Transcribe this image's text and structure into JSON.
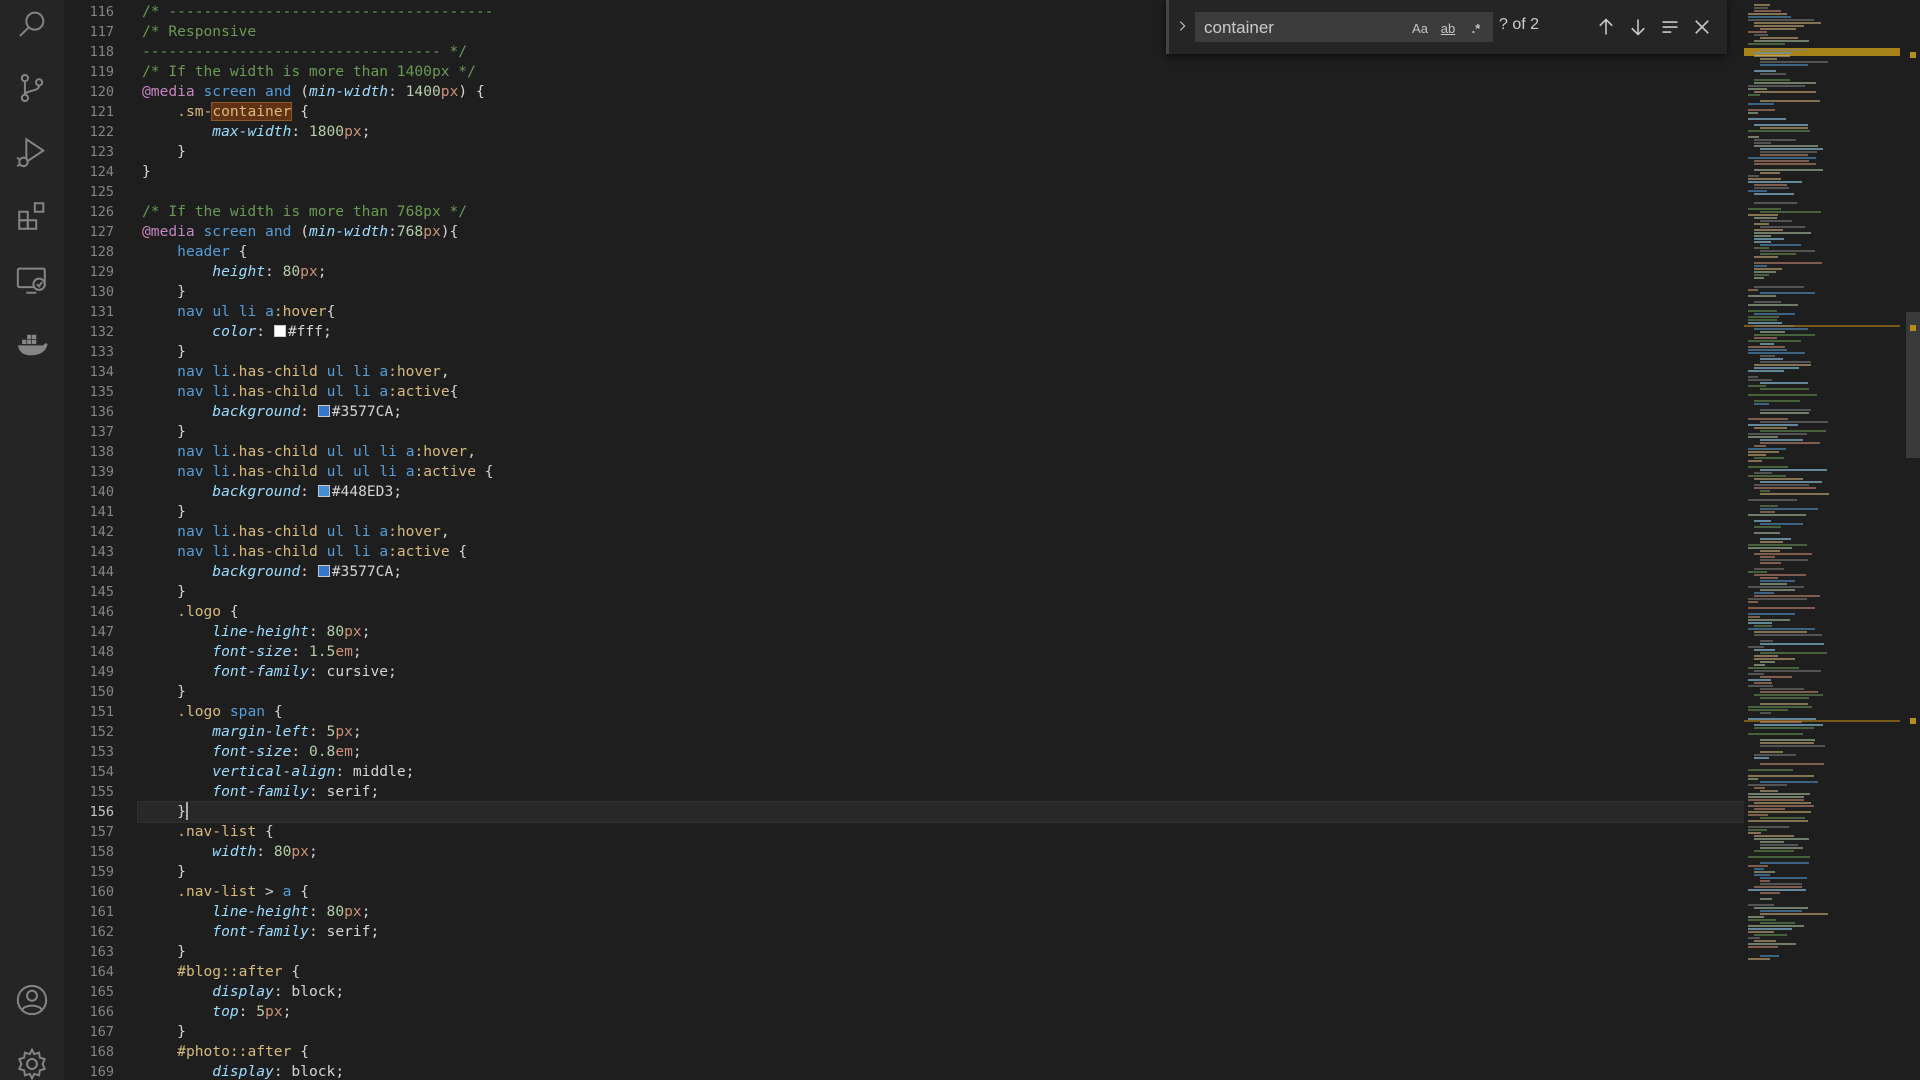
{
  "find": {
    "query": "container",
    "match_case_label": "Aa",
    "whole_word_label": "ab",
    "regex_label": ".*",
    "match_count": "? of 2"
  },
  "icons": {
    "activity": [
      "search-icon",
      "source-control-icon",
      "run-debug-icon",
      "extensions-icon",
      "remote-explorer-icon",
      "docker-icon",
      "account-icon",
      "settings-gear-icon"
    ],
    "find": [
      "chevron-right-icon",
      "arrow-up-icon",
      "arrow-down-icon",
      "find-in-selection-icon",
      "close-icon"
    ]
  },
  "colors": {
    "editor_bg": "#1e1e1e",
    "activity_bar_bg": "#252526",
    "find_match": "#613214",
    "minimap_highlight": "#b58d18"
  },
  "editor": {
    "current_line": 156,
    "lines": [
      {
        "n": "116",
        "text": "/* -------------------------------------"
      },
      {
        "n": "117",
        "text": "/* Responsive"
      },
      {
        "n": "118",
        "text": "---------------------------------- */"
      },
      {
        "n": "119",
        "text": "/* If the width is more than 1400px */"
      },
      {
        "n": "120",
        "text": "@media screen and (min-width: 1400px) {"
      },
      {
        "n": "121",
        "text": "    .sm-container {"
      },
      {
        "n": "122",
        "text": "        max-width: 1800px;"
      },
      {
        "n": "123",
        "text": "    }"
      },
      {
        "n": "124",
        "text": "}"
      },
      {
        "n": "125",
        "text": ""
      },
      {
        "n": "126",
        "text": "/* If the width is more than 768px */"
      },
      {
        "n": "127",
        "text": "@media screen and (min-width:768px){"
      },
      {
        "n": "128",
        "text": "    header {"
      },
      {
        "n": "129",
        "text": "        height: 80px;"
      },
      {
        "n": "130",
        "text": "    }"
      },
      {
        "n": "131",
        "text": "    nav ul li a:hover{"
      },
      {
        "n": "132",
        "text": "        color: #fff;"
      },
      {
        "n": "133",
        "text": "    }"
      },
      {
        "n": "134",
        "text": "    nav li.has-child ul li a:hover,"
      },
      {
        "n": "135",
        "text": "    nav li.has-child ul li a:active{"
      },
      {
        "n": "136",
        "text": "        background: #3577CA;"
      },
      {
        "n": "137",
        "text": "    }"
      },
      {
        "n": "138",
        "text": "    nav li.has-child ul ul li a:hover,"
      },
      {
        "n": "139",
        "text": "    nav li.has-child ul ul li a:active {"
      },
      {
        "n": "140",
        "text": "        background: #448ED3;"
      },
      {
        "n": "141",
        "text": "    }"
      },
      {
        "n": "142",
        "text": "    nav li.has-child ul li a:hover,"
      },
      {
        "n": "143",
        "text": "    nav li.has-child ul li a:active {"
      },
      {
        "n": "144",
        "text": "        background: #3577CA;"
      },
      {
        "n": "145",
        "text": "    }"
      },
      {
        "n": "146",
        "text": "    .logo {"
      },
      {
        "n": "147",
        "text": "        line-height: 80px;"
      },
      {
        "n": "148",
        "text": "        font-size: 1.5em;"
      },
      {
        "n": "149",
        "text": "        font-family: cursive;"
      },
      {
        "n": "150",
        "text": "    }"
      },
      {
        "n": "151",
        "text": "    .logo span {"
      },
      {
        "n": "152",
        "text": "        margin-left: 5px;"
      },
      {
        "n": "153",
        "text": "        font-size: 0.8em;"
      },
      {
        "n": "154",
        "text": "        vertical-align: middle;"
      },
      {
        "n": "155",
        "text": "        font-family: serif;"
      },
      {
        "n": "156",
        "text": "    }"
      },
      {
        "n": "157",
        "text": "    .nav-list {"
      },
      {
        "n": "158",
        "text": "        width: 80px;"
      },
      {
        "n": "159",
        "text": "    }"
      },
      {
        "n": "160",
        "text": "    .nav-list > a {"
      },
      {
        "n": "161",
        "text": "        line-height: 80px;"
      },
      {
        "n": "162",
        "text": "        font-family: serif;"
      },
      {
        "n": "163",
        "text": "    }"
      },
      {
        "n": "164",
        "text": "    #blog::after {"
      },
      {
        "n": "165",
        "text": "        display: block;"
      },
      {
        "n": "166",
        "text": "        top: 5px;"
      },
      {
        "n": "167",
        "text": "    }"
      },
      {
        "n": "168",
        "text": "    #photo::after {"
      },
      {
        "n": "169",
        "text": "        display: block;"
      }
    ]
  }
}
